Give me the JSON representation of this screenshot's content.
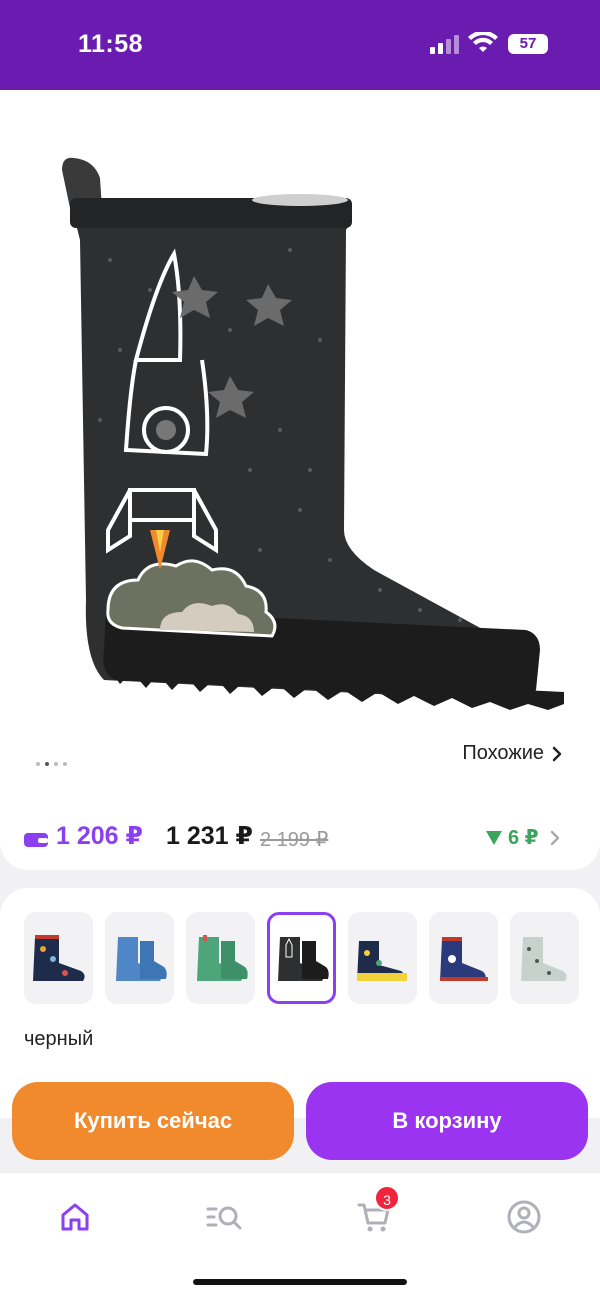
{
  "status_bar": {
    "time": "11:58",
    "battery": "57"
  },
  "gallery": {
    "similar_label": "Похожие",
    "dots_count": 4,
    "active_dot": 1
  },
  "price": {
    "card_price": "1 206 ₽",
    "price": "1 231 ₽",
    "old_price": "2 199 ₽",
    "bonus": "6 ₽"
  },
  "colors": {
    "selected_name": "черный",
    "variants": [
      {
        "name": "navy-print"
      },
      {
        "name": "blue"
      },
      {
        "name": "green"
      },
      {
        "name": "black",
        "selected": true
      },
      {
        "name": "navy-yellow"
      },
      {
        "name": "navy-red"
      },
      {
        "name": "grey-print"
      }
    ]
  },
  "actions": {
    "buy_now": "Купить сейчас",
    "add_to_cart": "В корзину"
  },
  "nav": {
    "cart_badge": "3"
  },
  "theme": {
    "accent": "#8a3ff0",
    "orange": "#f08a2c",
    "header": "#6a1bb0",
    "bonus_green": "#3ba55c"
  }
}
